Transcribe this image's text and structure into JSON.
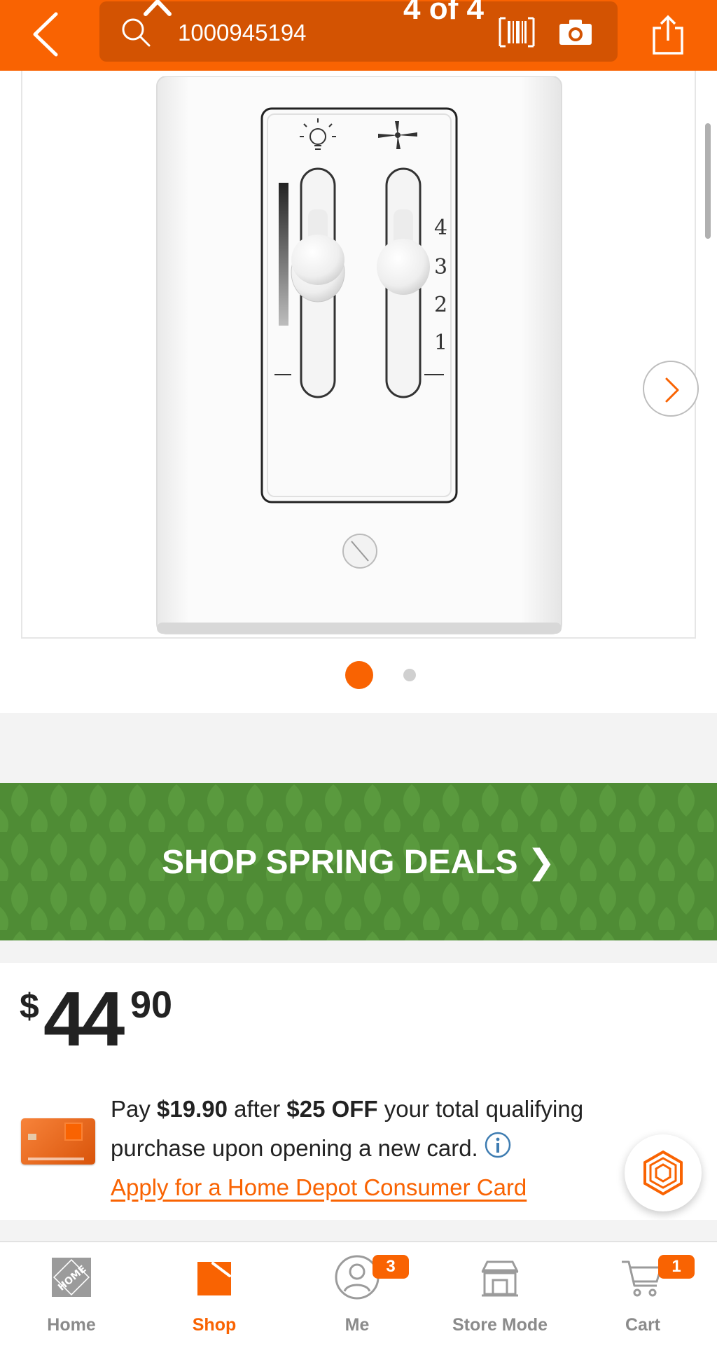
{
  "header": {
    "search_value": "1000945194",
    "gallery_count": "4 of 4"
  },
  "gallery": {
    "image_index": 1,
    "image_total": 2
  },
  "banner": {
    "label": "SHOP SPRING DEALS ❯",
    "background": "#4f8c35"
  },
  "price": {
    "currency": "$",
    "dollars": "44",
    "cents": "90"
  },
  "promo": {
    "text_1": "Pay ",
    "amount": "$19.90",
    "text_2": " after ",
    "discount": "$25 OFF",
    "text_3": " your total qualifying purchase upon opening a new card.",
    "link": "Apply for a Home Depot Consumer Card"
  },
  "tabs": [
    {
      "label": "Home",
      "icon": "home-depot-logo-icon"
    },
    {
      "label": "Shop",
      "icon": "shop-icon"
    },
    {
      "label": "Me",
      "icon": "user-icon",
      "badge": "3"
    },
    {
      "label": "Store Mode",
      "icon": "store-icon"
    },
    {
      "label": "Cart",
      "icon": "cart-icon",
      "badge": "1"
    }
  ],
  "colors": {
    "brand": "#f96302",
    "search_bg": "#d35302",
    "tab_inactive": "#8b8b8b"
  }
}
